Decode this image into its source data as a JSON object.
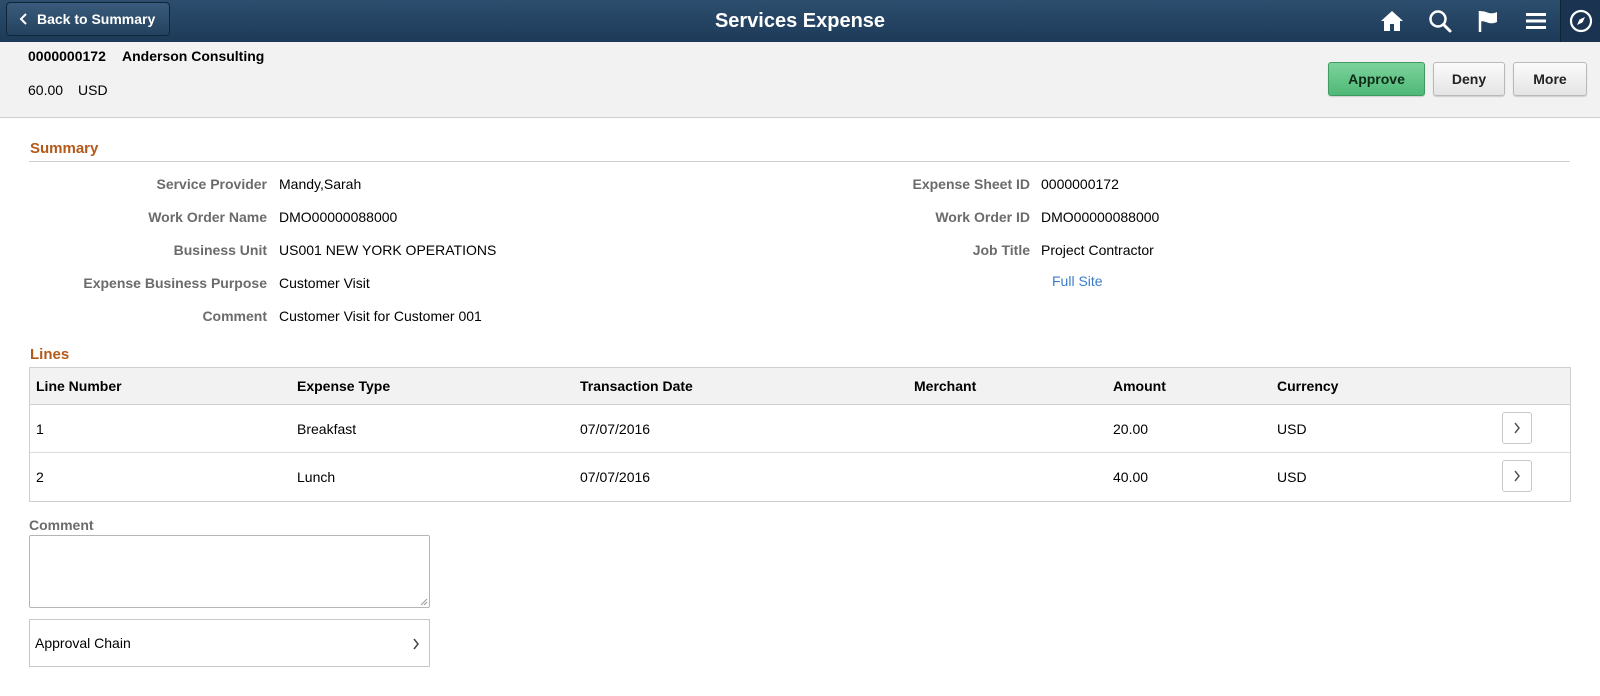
{
  "header": {
    "back_label": "Back to Summary",
    "title": "Services Expense",
    "icons": [
      "home-icon",
      "search-icon",
      "flag-icon",
      "menu-icon",
      "compass-icon"
    ]
  },
  "summary_strip": {
    "sheet_id": "0000000172",
    "vendor": "Anderson Consulting",
    "amount": "60.00",
    "currency": "USD"
  },
  "actions": {
    "approve": "Approve",
    "deny": "Deny",
    "more": "More"
  },
  "colors": {
    "banner": "#1d3a58",
    "section_title": "#b35a1b",
    "approve": "#5cc083",
    "link": "#3b7dc9"
  },
  "summary": {
    "title": "Summary",
    "left": [
      {
        "label": "Service Provider",
        "value": "Mandy,Sarah"
      },
      {
        "label": "Work Order Name",
        "value": "DMO00000088000"
      },
      {
        "label": "Business Unit",
        "value": "US001 NEW YORK OPERATIONS"
      },
      {
        "label": "Expense Business Purpose",
        "value": "Customer Visit"
      },
      {
        "label": "Comment",
        "value": "Customer Visit for Customer 001"
      }
    ],
    "right": [
      {
        "label": "Expense Sheet ID",
        "value": "0000000172"
      },
      {
        "label": "Work Order ID",
        "value": "DMO00000088000"
      },
      {
        "label": "Job Title",
        "value": "Project Contractor"
      }
    ],
    "full_site_link": "Full Site"
  },
  "lines": {
    "title": "Lines",
    "columns": [
      "Line Number",
      "Expense Type",
      "Transaction Date",
      "Merchant",
      "Amount",
      "Currency"
    ],
    "rows": [
      {
        "line": "1",
        "type": "Breakfast",
        "date": "07/07/2016",
        "merchant": "",
        "amount": "20.00",
        "currency": "USD"
      },
      {
        "line": "2",
        "type": "Lunch",
        "date": "07/07/2016",
        "merchant": "",
        "amount": "40.00",
        "currency": "USD"
      }
    ]
  },
  "comment": {
    "label": "Comment",
    "value": ""
  },
  "approval_chain": {
    "label": "Approval Chain"
  }
}
